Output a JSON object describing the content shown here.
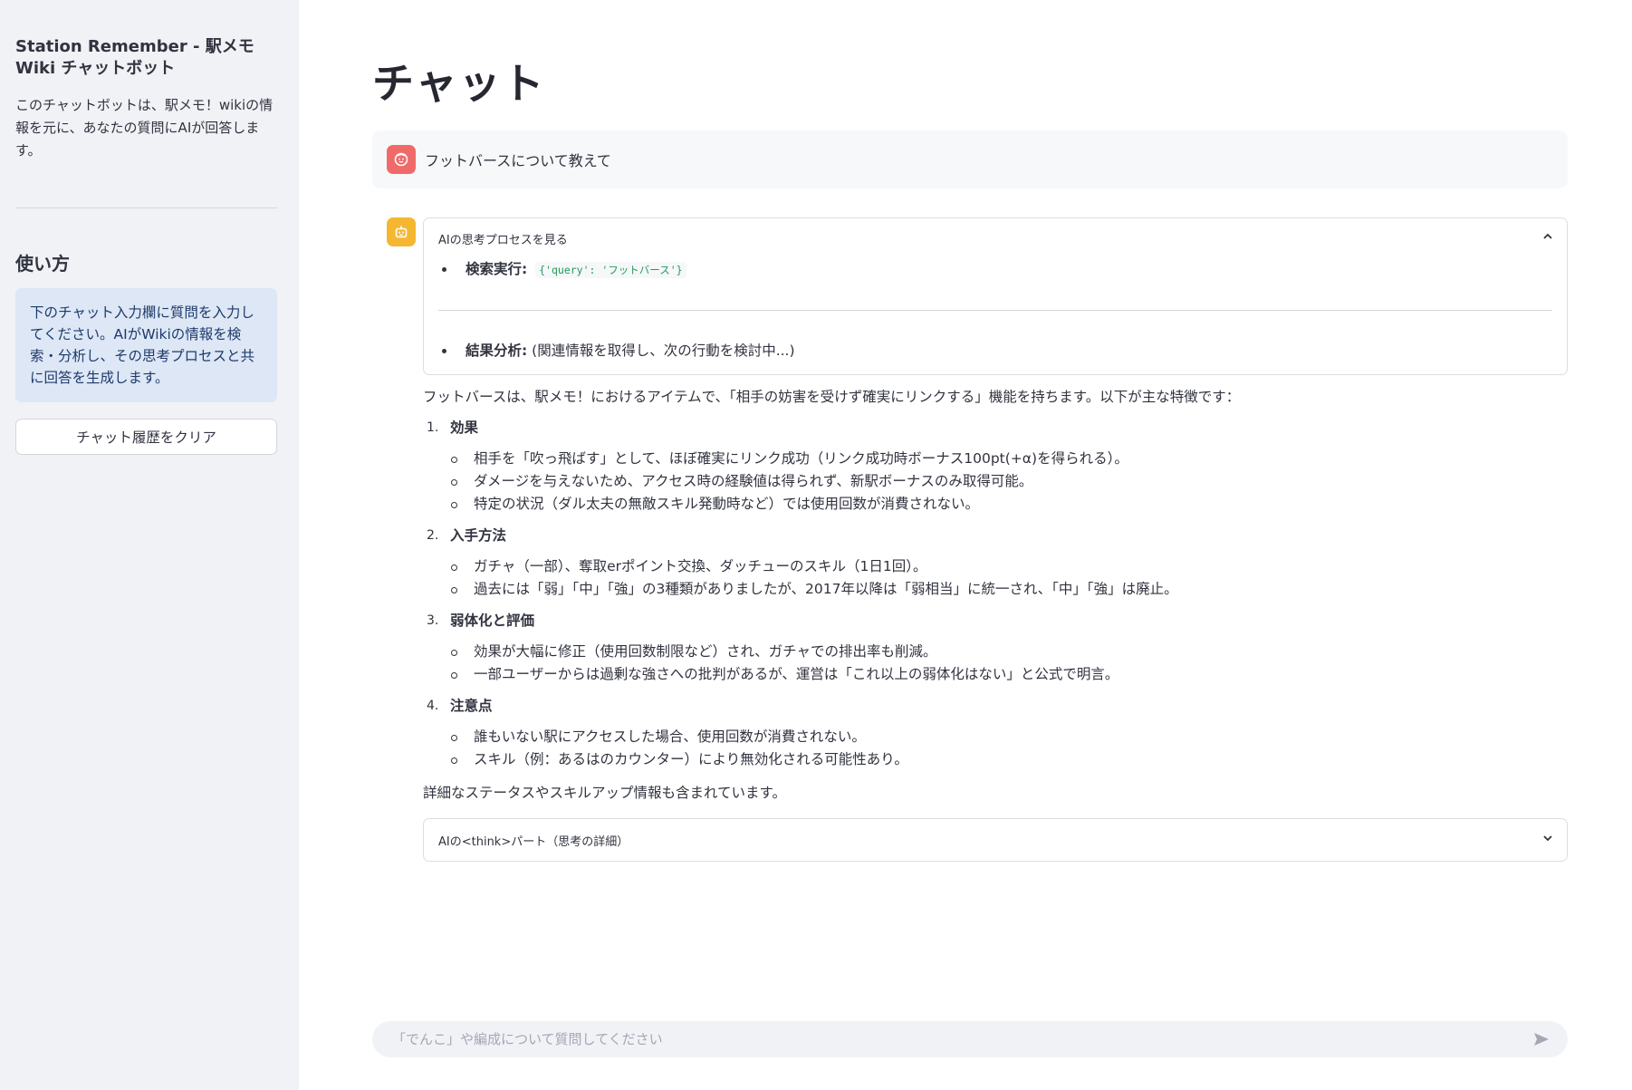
{
  "sidebar": {
    "title": "Station Remember - 駅メモWiki チャットボット",
    "description": "このチャットボットは、駅メモ！wikiの情報を元に、あなたの質問にAIが回答します。",
    "howto_heading": "使い方",
    "howto_text": "下のチャット入力欄に質問を入力してください。AIがWikiの情報を検索・分析し、その思考プロセスと共に回答を生成します。",
    "clear_button": "チャット履歴をクリア"
  },
  "main": {
    "title": "チャット",
    "user_message": "フットバースについて教えて",
    "thinking_expander": {
      "label": "AIの思考プロセスを見る",
      "items": [
        {
          "label": "検索実行:",
          "code": "{'query': 'フットバース'}"
        },
        {
          "label": "結果分析:",
          "text": "(関連情報を取得し、次の行動を検討中...)"
        }
      ]
    },
    "answer": {
      "intro": "フットバースは、駅メモ！におけるアイテムで、「相手の妨害を受けず確実にリンクする」機能を持ちます。以下が主な特徴です：",
      "sections": [
        {
          "num": "1.",
          "heading": "効果",
          "bullets": [
            "相手を「吹っ飛ばす」として、ほぼ確実にリンク成功（リンク成功時ボーナス100pt(+α)を得られる）。",
            "ダメージを与えないため、アクセス時の経験値は得られず、新駅ボーナスのみ取得可能。",
            "特定の状況（ダル太夫の無敵スキル発動時など）では使用回数が消費されない。"
          ]
        },
        {
          "num": "2.",
          "heading": "入手方法",
          "bullets": [
            "ガチャ（一部）、奪取erポイント交換、ダッチューのスキル（1日1回）。",
            "過去には「弱」「中」「強」の3種類がありましたが、2017年以降は「弱相当」に統一され、「中」「強」は廃止。"
          ]
        },
        {
          "num": "3.",
          "heading": "弱体化と評価",
          "bullets": [
            "効果が大幅に修正（使用回数制限など）され、ガチャでの排出率も削減。",
            "一部ユーザーからは過剰な強さへの批判があるが、運営は「これ以上の弱体化はない」と公式で明言。"
          ]
        },
        {
          "num": "4.",
          "heading": "注意点",
          "bullets": [
            "誰もいない駅にアクセスした場合、使用回数が消費されない。",
            "スキル（例：あるはのカウンター）により無効化される可能性あり。"
          ]
        }
      ],
      "closing": "詳細なステータスやスキルアップ情報も含まれています。"
    },
    "think_expander": {
      "label": "AIの<think>パート（思考の詳細）"
    }
  },
  "chat_input": {
    "placeholder": "「でんこ」や編成について質問してください"
  },
  "colors": {
    "sidebar_bg": "#f0f2f6",
    "user_avatar": "#f06a6a",
    "bot_avatar": "#f5b731",
    "info_bg": "#dde7f5"
  }
}
